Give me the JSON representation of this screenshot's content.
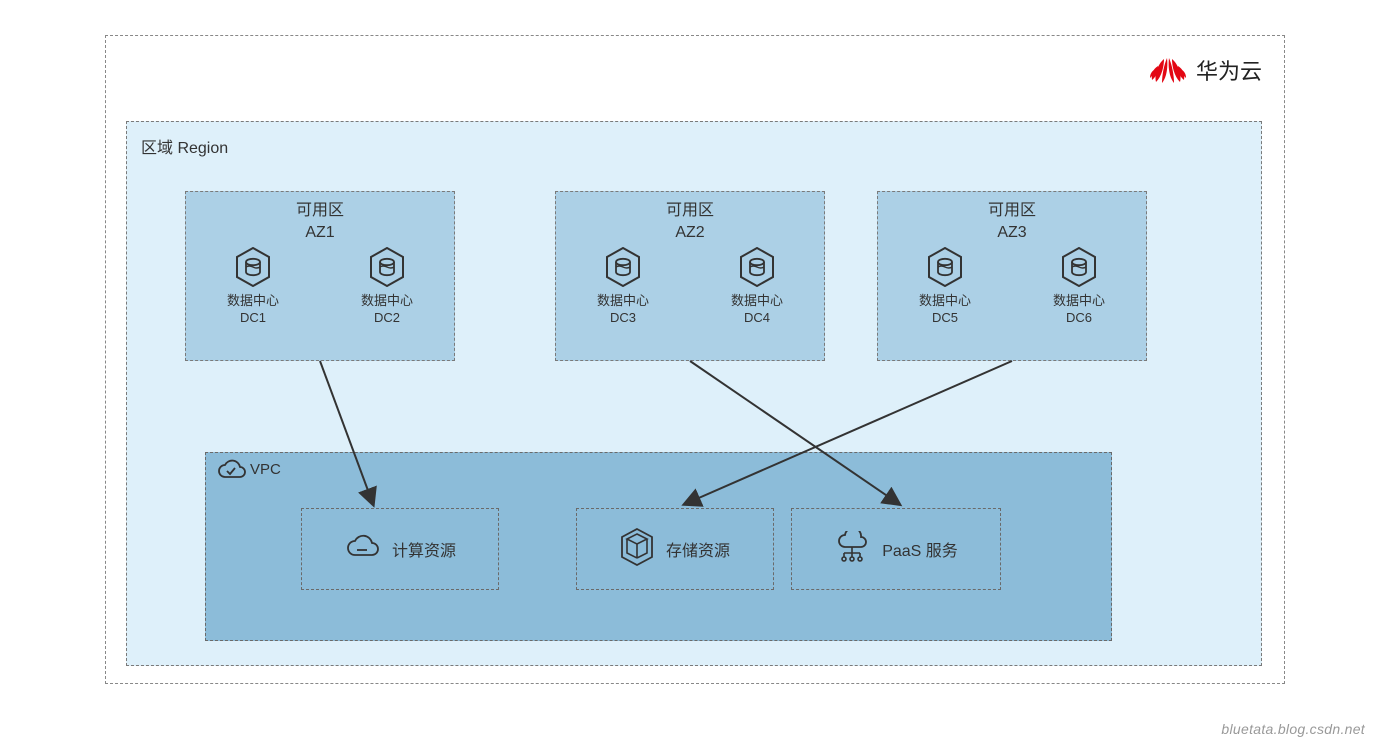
{
  "brand": {
    "label": "华为云"
  },
  "region": {
    "title": "区域 Region"
  },
  "azs": [
    {
      "title_cn": "可用区",
      "title_en": "AZ1",
      "dcs": [
        {
          "label": "数据中心",
          "id": "DC1"
        },
        {
          "label": "数据中心",
          "id": "DC2"
        }
      ]
    },
    {
      "title_cn": "可用区",
      "title_en": "AZ2",
      "dcs": [
        {
          "label": "数据中心",
          "id": "DC3"
        },
        {
          "label": "数据中心",
          "id": "DC4"
        }
      ]
    },
    {
      "title_cn": "可用区",
      "title_en": "AZ3",
      "dcs": [
        {
          "label": "数据中心",
          "id": "DC5"
        },
        {
          "label": "数据中心",
          "id": "DC6"
        }
      ]
    }
  ],
  "vpc": {
    "label": "VPC",
    "resources": [
      {
        "label": "计算资源"
      },
      {
        "label": "存储资源"
      },
      {
        "label": "PaaS 服务"
      }
    ]
  },
  "arrows": [
    {
      "from": "AZ1",
      "to": "计算资源"
    },
    {
      "from": "AZ2",
      "to": "PaaS 服务"
    },
    {
      "from": "AZ3",
      "to": "存储资源"
    }
  ],
  "watermark": "bluetata.blog.csdn.net"
}
